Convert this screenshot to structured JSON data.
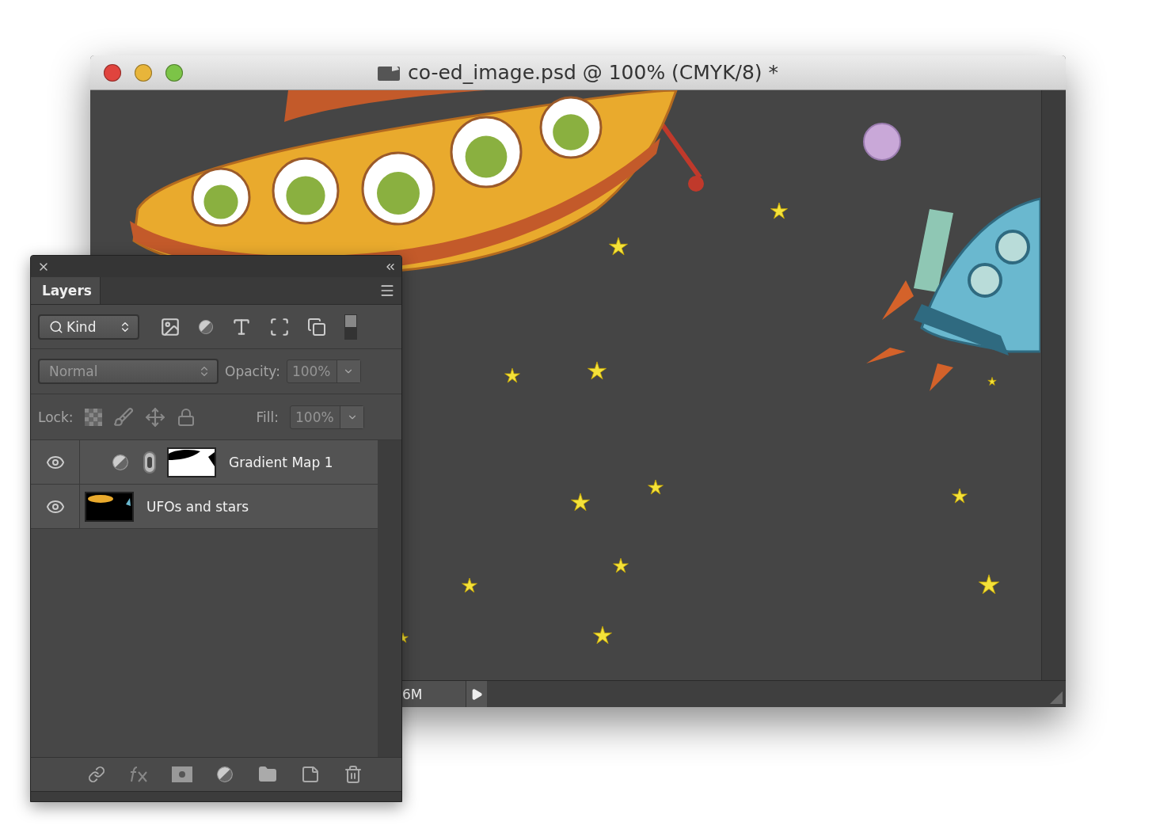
{
  "document": {
    "title": "co-ed_image.psd @ 100% (CMYK/8) *",
    "status": "6M"
  },
  "layers_panel": {
    "tab": "Layers",
    "filter": "Kind",
    "blend_mode": "Normal",
    "opacity_label": "Opacity:",
    "opacity": "100%",
    "lock_label": "Lock:",
    "fill_label": "Fill:",
    "fill": "100%",
    "controls_disabled": true,
    "layers": [
      {
        "kind": "adjustment",
        "name": "Gradient Map 1",
        "visible": true
      },
      {
        "kind": "pixel",
        "name": "UFOs and stars",
        "visible": true
      }
    ]
  }
}
